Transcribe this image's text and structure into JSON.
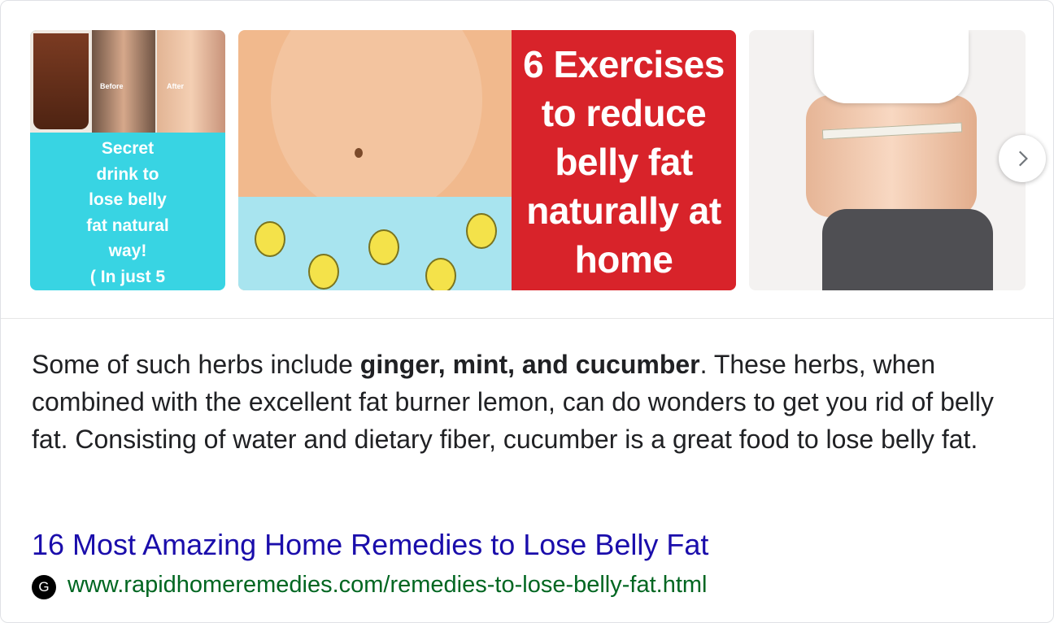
{
  "carousel": {
    "images": [
      {
        "before_tag": "Before",
        "after_tag": "After",
        "caption_lines": [
          "Secret",
          "drink to",
          "lose belly",
          "fat natural",
          "way!",
          "( In just 5"
        ]
      },
      {
        "caption_lines": [
          "6 Exercises",
          "to reduce",
          "belly fat",
          "naturally at",
          "home"
        ]
      },
      {}
    ],
    "next_icon": "chevron-right-icon"
  },
  "snippet": {
    "before": "Some of such herbs include ",
    "bold": "ginger, mint, and cucumber",
    "after": ". These herbs, when combined with the excellent fat burner lemon, can do wonders to get you rid of belly fat. Consisting of water and dietary fiber, cucumber is a great food to lose belly fat."
  },
  "result": {
    "title": "16 Most Amazing Home Remedies to Lose Belly Fat",
    "favicon_letter": "G",
    "url": "www.rapidhomeremedies.com/remedies-to-lose-belly-fat.html"
  },
  "colors": {
    "link": "#1a0dab",
    "url": "#006621",
    "text": "#202124",
    "caption_bg_1": "#38d4e3",
    "caption_bg_2": "#d8232a"
  }
}
